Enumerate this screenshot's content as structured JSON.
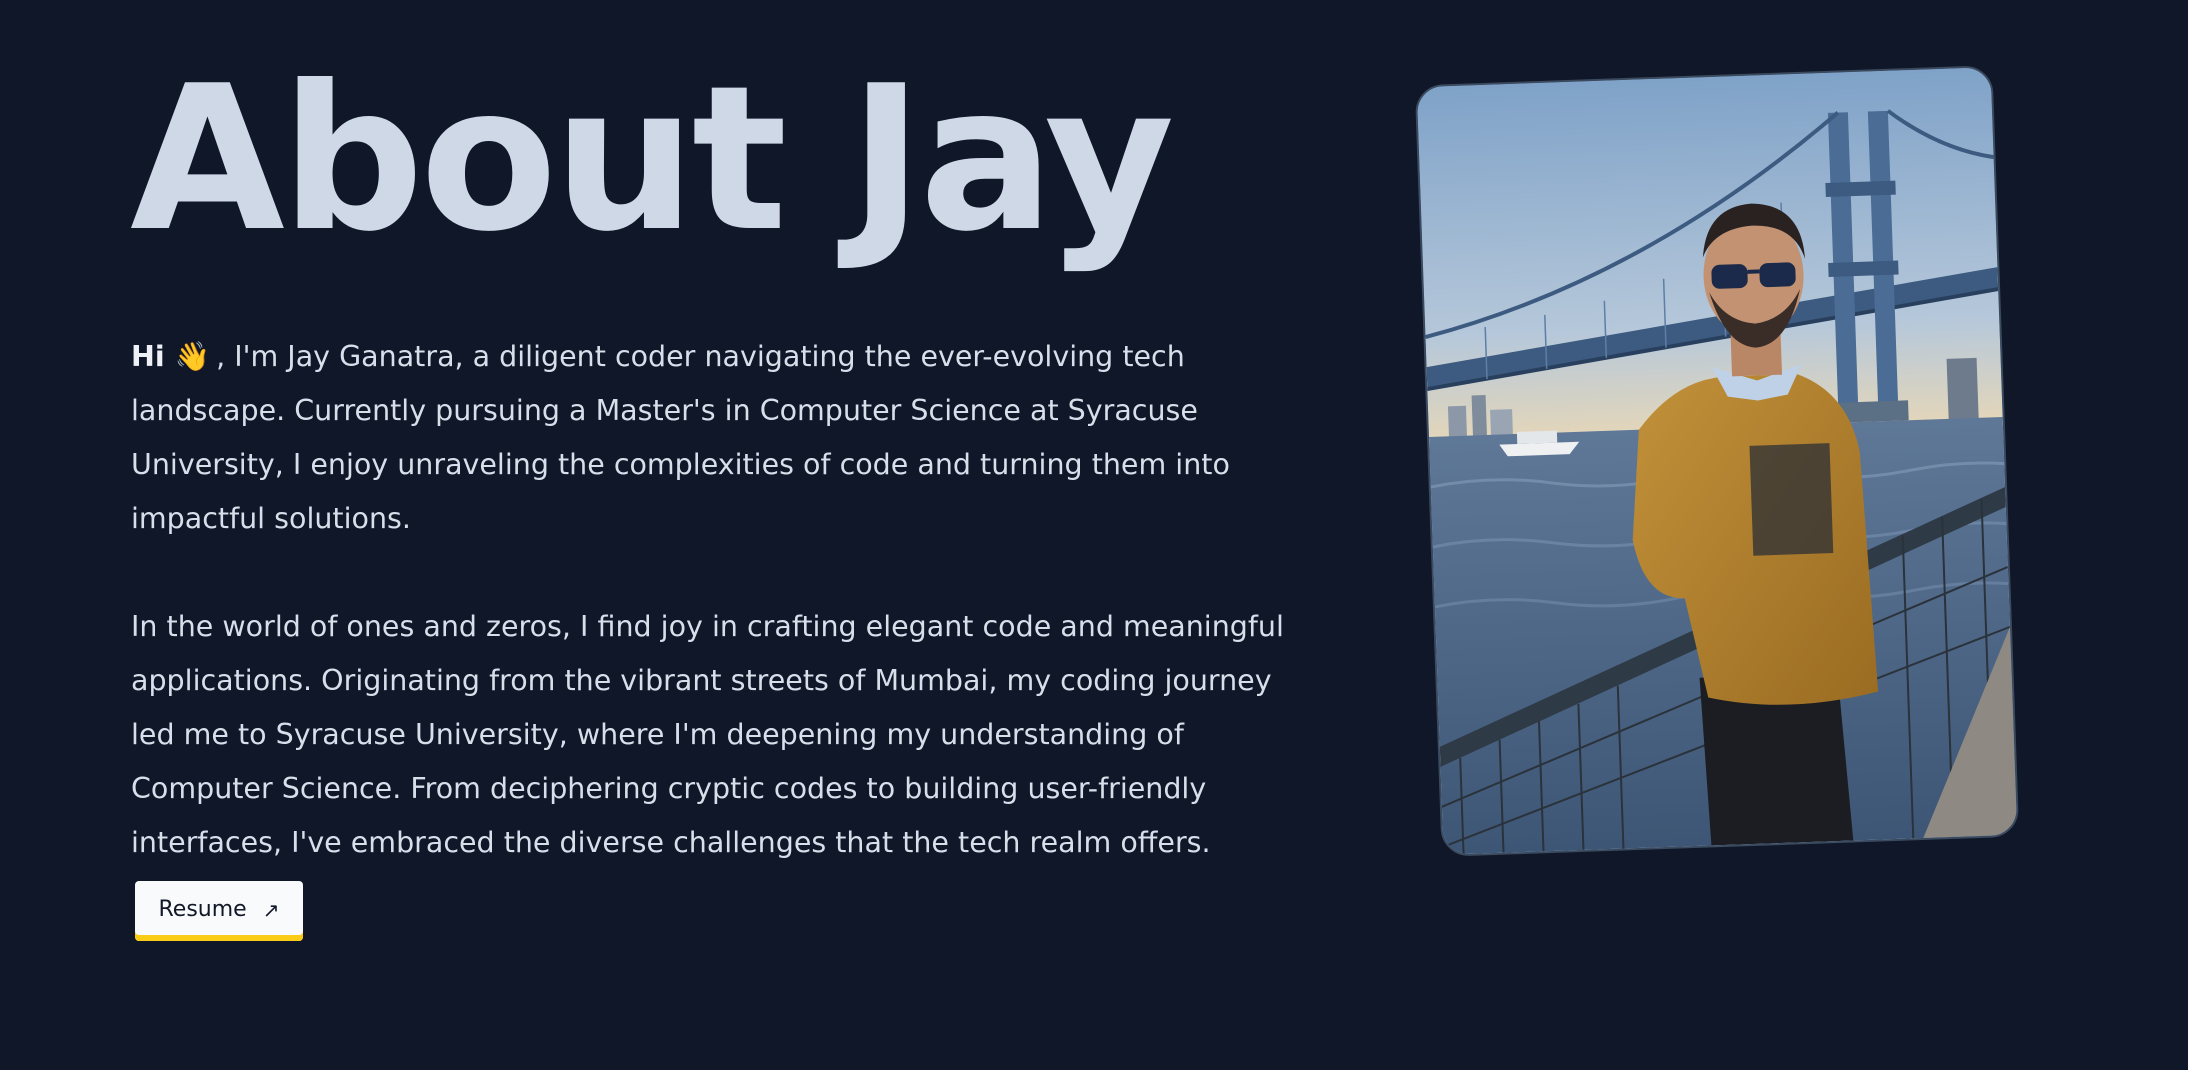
{
  "heading": "About Jay",
  "bio": {
    "greeting": "Hi",
    "wave_emoji": "👋",
    "paragraph1_rest": ", I'm Jay Ganatra, a diligent coder navigating the ever-evolving tech landscape. Currently pursuing a Master's in Computer Science at Syracuse University, I enjoy unraveling the complexities of code and turning them into impactful solutions.",
    "paragraph2": "In the world of ones and zeros, I find joy in crafting elegant code and meaningful applications. Originating from the vibrant streets of Mumbai, my coding journey led me to Syracuse University, where I'm deepening my understanding of Computer Science. From deciphering cryptic codes to building user-friendly interfaces, I've embraced the diverse challenges that the tech realm offers."
  },
  "resume_button": {
    "label": "Resume",
    "icon": "arrow-up-right-icon",
    "arrow_glyph": "↗"
  },
  "photo": {
    "subject": "profile-photo"
  },
  "colors": {
    "background": "#0f1729",
    "heading": "#cfd8e6",
    "text": "#d7dfea",
    "button_bg": "#f8fafc",
    "button_accent": "#facc15"
  }
}
